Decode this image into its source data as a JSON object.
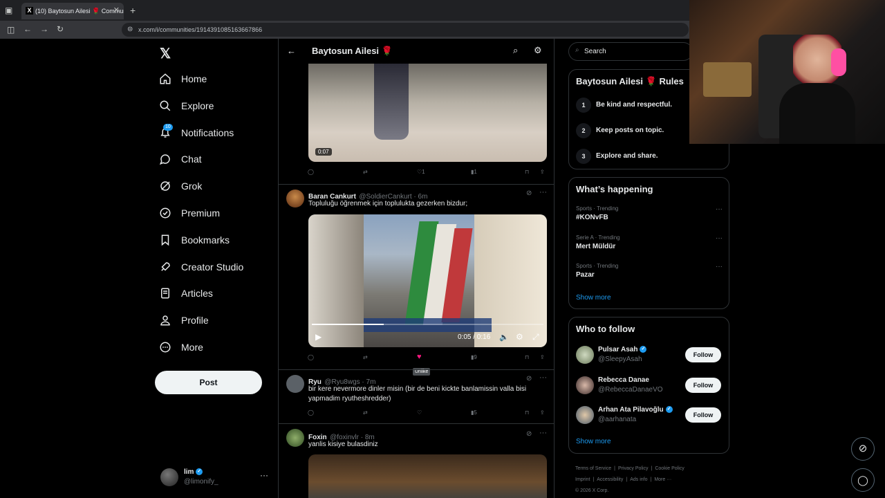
{
  "browser": {
    "tab_title": "(10) Baytosun Ailesi 🌹 Communi",
    "url": "x.com/i/communities/1914391085163667866"
  },
  "nav": {
    "items": [
      {
        "label": "Home",
        "icon": "home-icon"
      },
      {
        "label": "Explore",
        "icon": "search-icon"
      },
      {
        "label": "Notifications",
        "icon": "bell-icon",
        "badge": "10"
      },
      {
        "label": "Chat",
        "icon": "chat-icon"
      },
      {
        "label": "Grok",
        "icon": "grok-icon"
      },
      {
        "label": "Premium",
        "icon": "premium-icon"
      },
      {
        "label": "Bookmarks",
        "icon": "bookmark-icon"
      },
      {
        "label": "Creator Studio",
        "icon": "rocket-icon"
      },
      {
        "label": "Articles",
        "icon": "article-icon"
      },
      {
        "label": "Profile",
        "icon": "profile-icon"
      },
      {
        "label": "More",
        "icon": "more-icon"
      }
    ],
    "post_label": "Post",
    "account_name": "lim",
    "account_handle": "@limonify_"
  },
  "community": {
    "title": "Baytosun Ailesi 🌹"
  },
  "tweets": [
    {
      "video_time": "0:07",
      "likes": "1",
      "views": "1"
    },
    {
      "name": "Baran Cankurt",
      "handle": "@SoldierCankurt · 6m",
      "text": "Topluluğu öğrenmek için toplulukta gezerken bizdur;",
      "video_time": "0:05 / 0:16",
      "views": "9",
      "tooltip": "Unlike"
    },
    {
      "name": "Ryu",
      "handle": "@Ryu8wgs · 7m",
      "text": "bir kere nevermore dinler misin (bir de beni kickte banlamissin valla bisi yapmadim ryutheshredder)",
      "views": "5"
    },
    {
      "name": "Foxin",
      "handle": "@foxinvlr · 8m",
      "text": "yanlis kisiye bulasdiniz"
    }
  ],
  "search": {
    "placeholder": "Search"
  },
  "rules": {
    "title": "Baytosun Ailesi 🌹 Rules",
    "items": [
      {
        "num": "1",
        "text": "Be kind and respectful."
      },
      {
        "num": "2",
        "text": "Keep posts on topic."
      },
      {
        "num": "3",
        "text": "Explore and share."
      }
    ]
  },
  "happening": {
    "title": "What’s happening",
    "items": [
      {
        "meta": "Sports · Trending",
        "topic": "#KONvFB"
      },
      {
        "meta": "Serie A · Trending",
        "topic": "Mert Müldür"
      },
      {
        "meta": "Sports · Trending",
        "topic": "Pazar"
      }
    ],
    "show_more": "Show more"
  },
  "who_to_follow": {
    "title": "Who to follow",
    "items": [
      {
        "name": "Pulsar Asah",
        "handle": "@SleepyAsah",
        "verified": true
      },
      {
        "name": "Rebecca Danae",
        "handle": "@RebeccaDanaeVO",
        "verified": false
      },
      {
        "name": "Arhan Ata Pilavoğlu",
        "handle": "@aarhanata",
        "verified": true
      }
    ],
    "follow_label": "Follow",
    "show_more": "Show more"
  },
  "footer": {
    "links": [
      "Terms of Service",
      "Privacy Policy",
      "Cookie Policy",
      "Imprint",
      "Accessibility",
      "Ads info",
      "More ···"
    ],
    "copyright": "© 2026 X Corp."
  },
  "colors": {
    "accent": "#1d9bf0",
    "like": "#f91880",
    "background": "#000000",
    "border": "#2f3336"
  }
}
